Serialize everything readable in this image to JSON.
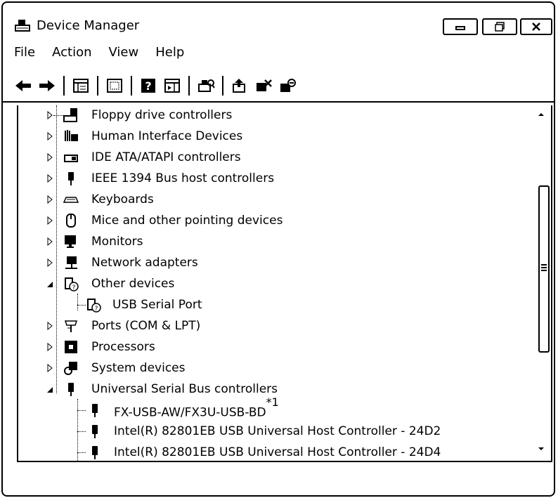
{
  "window": {
    "title": "Device Manager",
    "title_icon": "device-manager-icon",
    "controls": {
      "minimize": "minimize-icon",
      "maximize": "maximize-icon",
      "close": "close-icon"
    }
  },
  "menu": [
    "File",
    "Action",
    "View",
    "Help"
  ],
  "toolbar": [
    "back-icon",
    "forward-icon",
    "properties-icon",
    "show-hide-console-tree-icon",
    "help-icon",
    "show-action-pane-icon",
    "scan-hardware-icon",
    "update-driver-icon",
    "disable-device-icon",
    "uninstall-device-icon"
  ],
  "tree": {
    "rows": [
      {
        "label": "Floppy drive controllers",
        "icon": "floppy-controller-icon",
        "state": "collapsed"
      },
      {
        "label": "Human Interface Devices",
        "icon": "hid-icon",
        "state": "collapsed"
      },
      {
        "label": "IDE ATA/ATAPI controllers",
        "icon": "ide-controller-icon",
        "state": "collapsed"
      },
      {
        "label": "IEEE 1394 Bus host controllers",
        "icon": "ieee1394-icon",
        "state": "collapsed"
      },
      {
        "label": "Keyboards",
        "icon": "keyboard-icon",
        "state": "collapsed"
      },
      {
        "label": "Mice and other pointing devices",
        "icon": "mouse-icon",
        "state": "collapsed"
      },
      {
        "label": "Monitors",
        "icon": "monitor-icon",
        "state": "collapsed"
      },
      {
        "label": "Network adapters",
        "icon": "network-adapter-icon",
        "state": "collapsed"
      },
      {
        "label": "Other devices",
        "icon": "unknown-device-icon",
        "state": "expanded"
      },
      {
        "label": "USB Serial Port",
        "icon": "unknown-device-icon",
        "state": "child"
      },
      {
        "label": "Ports (COM & LPT)",
        "icon": "port-icon",
        "state": "collapsed"
      },
      {
        "label": "Processors",
        "icon": "processor-icon",
        "state": "collapsed"
      },
      {
        "label": "System devices",
        "icon": "system-device-icon",
        "state": "collapsed"
      },
      {
        "label": "Universal Serial Bus controllers",
        "icon": "usb-icon",
        "state": "expanded"
      },
      {
        "label": "FX-USB-AW/FX3U-USB-BD",
        "icon": "usb-icon",
        "state": "child",
        "footnote": "*1"
      },
      {
        "label": "Intel(R) 82801EB USB Universal Host Controller - 24D2",
        "icon": "usb-icon",
        "state": "child"
      },
      {
        "label": "Intel(R) 82801EB USB Universal Host Controller - 24D4",
        "icon": "usb-icon",
        "state": "child"
      }
    ]
  },
  "scrollbar": {
    "up": "scroll-up-arrow-icon",
    "down": "scroll-down-arrow-icon",
    "thumb_position": 0.45
  }
}
